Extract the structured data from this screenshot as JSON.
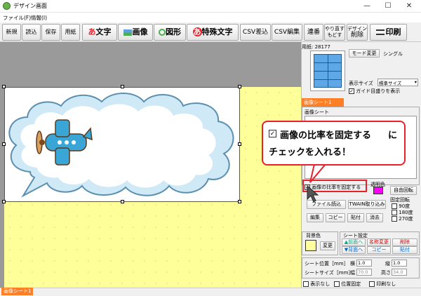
{
  "window": {
    "title": "デザイン画面",
    "minimize": "—",
    "maximize": "☐",
    "close": "✕"
  },
  "menu": [
    {
      "label": "ファイル(F)"
    },
    {
      "label": "情報(I)"
    }
  ],
  "toolbar": {
    "new": "新規",
    "open": "読込",
    "save": "保存",
    "paper": "用紙",
    "text": "文字",
    "image": "画像",
    "shape": "図形",
    "special_text": "特殊文字",
    "csv_insert": "CSV差込",
    "csv_edit": "CSV編集",
    "serial": "連番",
    "undo_line1": "やり直す",
    "undo_line2": "もどす",
    "delete_line1": "デザイン",
    "delete_line2": "削除",
    "print": "印刷",
    "text_icon": "あ",
    "special_icon": "あ"
  },
  "right_panel": {
    "form_number": "用紙: 28177",
    "mode_change": "モード変更",
    "mode": "シングル",
    "display_size_label": "表示サイズ",
    "display_size_value": "標準サイズ",
    "guide_label": "ガイド目盛りを表示",
    "sheet_tab": "画像シート1",
    "sheet_group": "画像シート",
    "fix_ratio": "画像の比率を固定する",
    "transparent_color": "透明色",
    "free_rotate": "自由回転",
    "file_load": "ファイル読込",
    "twain_load": "TWAIN取り込み",
    "fixed_rotate": "固定回転",
    "rot90": "90度",
    "rot180": "180度",
    "rot270": "270度",
    "edit": "編集",
    "copy": "コピー",
    "paste": "貼付",
    "erase": "消去",
    "background_color": "背景色",
    "change": "変更",
    "sheet_settings": "シート設定",
    "move_front": "▲前面へ",
    "move_back": "▼背面へ",
    "rename": "名称変更",
    "sheet_copy": "コピー",
    "sheet_delete": "削除",
    "sheet_paste": "貼付",
    "position_label": "シート位置［mm］",
    "size_label": "シートサイズ［mm］",
    "horizontal": "横",
    "horizontal_value": "1.0",
    "vertical": "縦",
    "vertical_value": "1.0",
    "width": "幅",
    "width_value": "70.0",
    "height": "高さ",
    "height_value": "34.0",
    "hide": "表示なし",
    "lock_position": "位置固定",
    "no_print": "印刷なし"
  },
  "callout": {
    "line1": "画像の比率を固定する",
    "line1_suffix": "に",
    "line2": "チェックを入れる！"
  },
  "status": {
    "tab": "画像シート1"
  },
  "colors": {
    "accent_red": "#e8202a",
    "paper_yellow": "#ffff99",
    "transparent_magenta": "#ff00ff",
    "bg_swatch": "#ffffa0",
    "tab_orange": "#ff7f27"
  }
}
